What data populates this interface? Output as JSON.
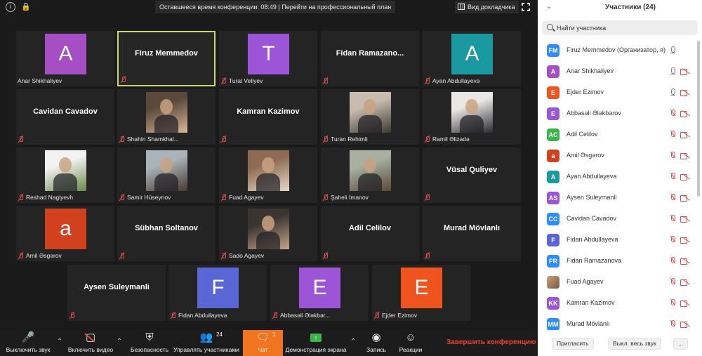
{
  "topbar": {
    "timer_text": "Оставшееся время конференции: 08:49 | Перейти на профессиональный план",
    "view_label": "Вид докладчика"
  },
  "tiles": [
    {
      "kind": "avatar",
      "letter": "A",
      "color": "#a64fc4",
      "name": "Anar Shikhaliyev",
      "muted": false
    },
    {
      "kind": "name",
      "big": "Firuz Memmedov",
      "active": true
    },
    {
      "kind": "avatar",
      "letter": "T",
      "color": "#9c55d6",
      "name": "Tural Veliyev",
      "muted": true
    },
    {
      "kind": "name",
      "big": "Fidan  Ramazano..."
    },
    {
      "kind": "avatar",
      "letter": "A",
      "color": "#1a9aa0",
      "name": "Ayan Abdullayeva",
      "muted": true
    },
    {
      "kind": "name",
      "big": "Cavidan Cavadov"
    },
    {
      "kind": "photo",
      "name": "Shahin Shamkhal...",
      "muted": true,
      "tone": [
        "#5b4a3c",
        "#d7b694"
      ]
    },
    {
      "kind": "name",
      "big": "Kamran Kazimov"
    },
    {
      "kind": "photo",
      "name": "Turan Rehimli",
      "muted": true,
      "tone": [
        "#c8bcae",
        "#3d3a34"
      ]
    },
    {
      "kind": "photo",
      "name": "Ramil Əlizadə",
      "muted": true,
      "tone": [
        "#e9e7e4",
        "#2b2b30"
      ]
    },
    {
      "kind": "photo",
      "name": "Reshad Nagiyevh",
      "muted": true,
      "tone": [
        "#f2f2f2",
        "#6a8a4a"
      ]
    },
    {
      "kind": "photo",
      "name": "Samir Hüseynov",
      "muted": true,
      "tone": [
        "#a9b3b8",
        "#4a3a30"
      ]
    },
    {
      "kind": "photo",
      "name": "Fuad Agayev",
      "muted": true,
      "tone": [
        "#8e6b52",
        "#e6d8c8"
      ]
    },
    {
      "kind": "photo",
      "name": "Şaheli İmanov",
      "muted": true,
      "tone": [
        "#a8b0a0",
        "#5a4a36"
      ]
    },
    {
      "kind": "name",
      "big": "Vüsal Quliyev"
    },
    {
      "kind": "avatar",
      "letter": "a",
      "color": "#d2411e",
      "name": "Amil Əsgərov",
      "muted": true
    },
    {
      "kind": "name",
      "big": "Sübhan Soltanov"
    },
    {
      "kind": "photo",
      "name": "Sado Agayev",
      "muted": true,
      "tone": [
        "#3b3532",
        "#c4a486"
      ]
    },
    {
      "kind": "name",
      "big": "Adil Celilov"
    },
    {
      "kind": "name",
      "big": "Murad Mövlanlı"
    },
    {
      "kind": "name",
      "big": "Aysen Suleymanli"
    },
    {
      "kind": "avatar",
      "letter": "F",
      "color": "#5a66d6",
      "name": "Fidan Abdullayeva",
      "muted": true
    },
    {
      "kind": "avatar",
      "letter": "E",
      "color": "#9c55d6",
      "name": "Abbasəli Ələkbər...",
      "muted": true
    },
    {
      "kind": "avatar",
      "letter": "E",
      "color": "#f0541e",
      "name": "Ejder Ezimov",
      "muted": true
    }
  ],
  "toolbar": {
    "mute_label": "Выключить звук",
    "video_label": "Включить видео",
    "security_label": "Безопасность",
    "participants_label": "Управлять участниками",
    "participants_count": "24",
    "chat_label": "Чат",
    "chat_badge": "1",
    "share_label": "Демонстрация экрана",
    "record_label": "Запись",
    "reactions_label": "Реакции",
    "end_label": "Завершить конференцию"
  },
  "panel": {
    "title": "Участники (24)",
    "search_placeholder": "Найти участника",
    "participants": [
      {
        "initials": "FM",
        "color": "#2d8cff",
        "name": "Firuz Memmedov (Организатор, я)",
        "mic": "live",
        "cam": false
      },
      {
        "initials": "A",
        "color": "#a64fc4",
        "name": "Anar Shikhaliyev",
        "mic": "live",
        "cam": true
      },
      {
        "initials": "E",
        "color": "#f0541e",
        "name": "Ejder Ezimov",
        "mic": "live",
        "cam": true
      },
      {
        "initials": "E",
        "color": "#9c55d6",
        "name": "Abbasəli Ələkbərov",
        "mic": "muted",
        "cam": true
      },
      {
        "initials": "AC",
        "color": "#3ab54a",
        "name": "Adil Celilov",
        "mic": "muted",
        "cam": true
      },
      {
        "initials": "a",
        "color": "#d2411e",
        "name": "Amil Əsgərov",
        "mic": "muted",
        "cam": true
      },
      {
        "initials": "A",
        "color": "#1a9aa0",
        "name": "Ayan Abdullayeva",
        "mic": "muted",
        "cam": true
      },
      {
        "initials": "AS",
        "color": "#9c55d6",
        "name": "Aysen Suleymanli",
        "mic": "muted",
        "cam": true
      },
      {
        "initials": "CC",
        "color": "#2d8cff",
        "name": "Cavidan Cavadov",
        "mic": "muted",
        "cam": true
      },
      {
        "initials": "F",
        "color": "#5a66d6",
        "name": "Fidan Abdullayeva",
        "mic": "muted",
        "cam": true
      },
      {
        "initials": "FR",
        "color": "#2d8cff",
        "name": "Fidan Ramazanova",
        "mic": "muted",
        "cam": true
      },
      {
        "initials": "",
        "color": "photo",
        "name": "Fuad Agayev",
        "mic": "muted",
        "cam": true
      },
      {
        "initials": "KK",
        "color": "#9c55d6",
        "name": "Kamran Kazimov",
        "mic": "muted",
        "cam": true
      },
      {
        "initials": "MM",
        "color": "#2d8cff",
        "name": "Murad Mövlanlı",
        "mic": "muted",
        "cam": true
      }
    ],
    "invite_label": "Пригласить",
    "mute_all_label": "Выкл. весь звук",
    "more_label": "..."
  }
}
